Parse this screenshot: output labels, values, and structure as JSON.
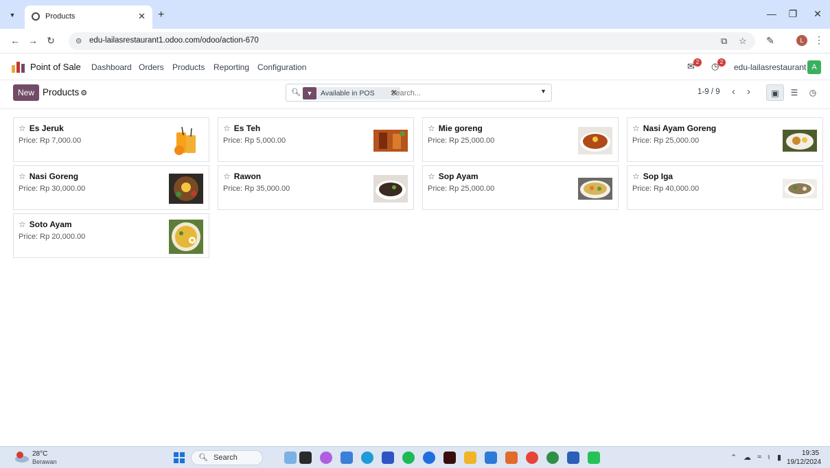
{
  "browser": {
    "tab_title": "Products",
    "url": "edu-lailasrestaurant1.odoo.com/odoo/action-670",
    "profile_initial": "L"
  },
  "odoo": {
    "app_name": "Point of Sale",
    "menu": [
      "Dashboard",
      "Orders",
      "Products",
      "Reporting",
      "Configuration"
    ],
    "chat_badge": "2",
    "activity_badge": "2",
    "company": "edu-lailasrestaurant",
    "user_initial": "A",
    "brand_color": "#714b67"
  },
  "control_panel": {
    "new_label": "New",
    "breadcrumb": "Products",
    "facet_label": "Available in POS",
    "search_placeholder": "Search...",
    "pager": "1-9 / 9"
  },
  "products": [
    {
      "name": "Es Jeruk",
      "price": "Price: Rp 7,000.00",
      "image": "orange-juice"
    },
    {
      "name": "Es Teh",
      "price": "Price: Rp 5,000.00",
      "image": "iced-tea"
    },
    {
      "name": "Mie goreng",
      "price": "Price: Rp 25,000.00",
      "image": "fried-noodles"
    },
    {
      "name": "Nasi Ayam Goreng",
      "price": "Price: Rp 25,000.00",
      "image": "fried-chicken-rice"
    },
    {
      "name": "Nasi Goreng",
      "price": "Price: Rp 30,000.00",
      "image": "fried-rice"
    },
    {
      "name": "Rawon",
      "price": "Price: Rp 35,000.00",
      "image": "rawon-soup"
    },
    {
      "name": "Sop Ayam",
      "price": "Price: Rp 25,000.00",
      "image": "chicken-soup"
    },
    {
      "name": "Sop Iga",
      "price": "Price: Rp 40,000.00",
      "image": "rib-soup"
    },
    {
      "name": "Soto Ayam",
      "price": "Price: Rp 20,000.00",
      "image": "soto-ayam"
    }
  ],
  "taskbar": {
    "weather_temp": "28°C",
    "weather_desc": "Berawan",
    "search_label": "Search",
    "time": "19:35",
    "date": "19/12/2024"
  }
}
